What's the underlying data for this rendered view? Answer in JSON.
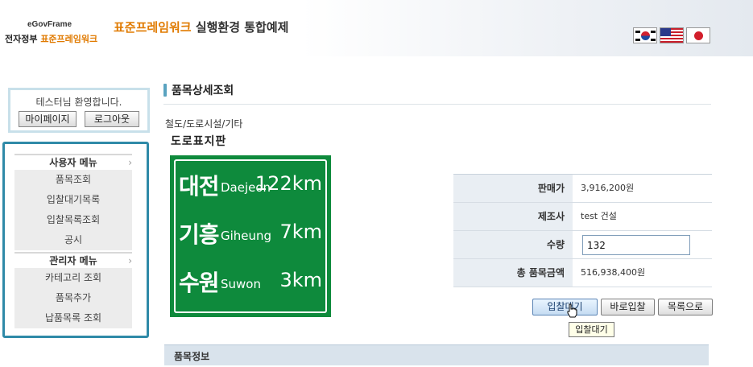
{
  "header": {
    "logo_top": "eGovFrame",
    "logo_bottom_prefix": "전자정부 ",
    "logo_bottom_accent": "표준프레임워크",
    "title_brand": "표준프레임워크",
    "title_rest": " 실행환경 통합예제",
    "flags": [
      "korea-flag-icon",
      "usa-flag-icon",
      "japan-flag-icon"
    ]
  },
  "login": {
    "welcome": "테스터님 환영합니다.",
    "mypage_label": "마이페이지",
    "logout_label": "로그아웃"
  },
  "menu": {
    "user_menu_title": "사용자 메뉴",
    "user_items": [
      "품목조회",
      "입찰대기목록",
      "입찰목록조회",
      "공시"
    ],
    "admin_menu_title": "관리자 메뉴",
    "admin_items": [
      "카테고리 조회",
      "품목추가",
      "납품목록 조회"
    ]
  },
  "main": {
    "section_title": "품목상세조회",
    "category": "철도/도로시설/기타",
    "item_name": "도로표지판",
    "sign": [
      {
        "ko": "대전",
        "en": "Daejeon",
        "km": "122km"
      },
      {
        "ko": "기흥",
        "en": "Giheung",
        "km": "7km"
      },
      {
        "ko": "수원",
        "en": "Suwon",
        "km": "3km"
      }
    ],
    "info": {
      "price_label": "판매가",
      "price_value": "3,916,200원",
      "maker_label": "제조사",
      "maker_value": "test 건설",
      "qty_label": "수량",
      "qty_value": "132",
      "total_label": "총 품목금액",
      "total_value": "516,938,400원"
    },
    "buttons": {
      "wait_label": "입찰대기",
      "direct_label": "바로입찰",
      "list_label": "목록으로"
    },
    "tooltip": "입찰대기",
    "subsection_title": "품목정보"
  },
  "colors": {
    "brand_orange": "#e07a00",
    "menu_border": "#2f8aa8",
    "sign_green": "#0e8a3c"
  }
}
